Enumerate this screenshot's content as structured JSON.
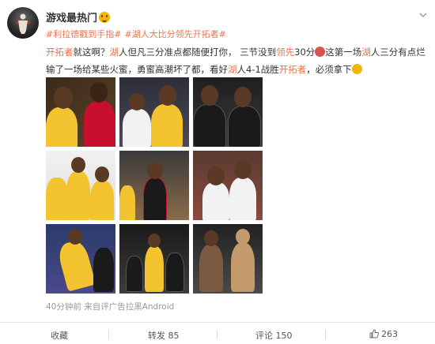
{
  "post": {
    "username": "游戏最热门",
    "tags": [
      "#利拉德戳到手指#",
      "#湖人大比分领先开拓者#"
    ],
    "text": {
      "line1": [
        {
          "t": "开拓者",
          "hl": true
        },
        {
          "t": "就这啊？",
          "hl": false
        },
        {
          "t": "湖",
          "hl": true
        },
        {
          "t": "人但凡三分准点都随便打你，  三节没到",
          "hl": false
        },
        {
          "t": "领先",
          "hl": true
        },
        {
          "t": "30分",
          "hl": false
        }
      ],
      "line1b": [
        {
          "t": "这第一场",
          "hl": false
        },
        {
          "t": "湖",
          "hl": true
        },
        {
          "t": "人三分有点烂",
          "hl": false
        }
      ],
      "line2": [
        {
          "t": "输了一场给某些火蜜，勇蜜高潮坏了都，看好",
          "hl": false
        },
        {
          "t": "湖",
          "hl": true
        },
        {
          "t": "人4-1战胜",
          "hl": false
        },
        {
          "t": "开拓者",
          "hl": true
        },
        {
          "t": "，必须拿下",
          "hl": false
        }
      ]
    },
    "time": "40分钟前",
    "source": "评广告拉黑Android"
  },
  "actions": {
    "favorite": "收藏",
    "repost": "转发 85",
    "comment": "评论 150",
    "like": "263"
  },
  "colors": {
    "accent": "#eb7350",
    "lakers_gold": "#f4c430",
    "lakers_purple": "#552583",
    "blazers_red": "#c8102e",
    "blazers_black": "#1a1a1a"
  }
}
